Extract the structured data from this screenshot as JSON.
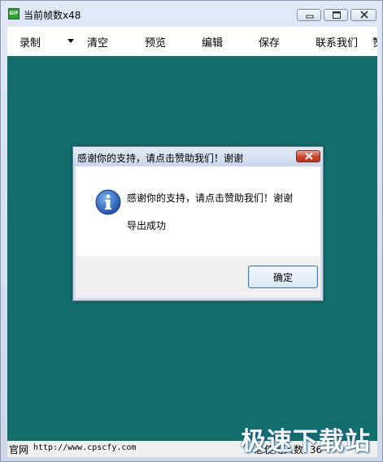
{
  "window": {
    "title": "当前帧数x48",
    "icon": "gif-app-icon"
  },
  "menu": {
    "items": [
      {
        "label": "录制",
        "has_dropdown": true
      },
      {
        "label": "清空"
      },
      {
        "label": "预览"
      },
      {
        "label": "编辑"
      },
      {
        "label": "保存"
      },
      {
        "label": "联系我们"
      },
      {
        "label": "赞"
      }
    ]
  },
  "canvas": {
    "background": "#136d6c"
  },
  "status": {
    "site_label": "官网",
    "site_url": "http://www.cpscfy.com",
    "count": "总使用人数: 36"
  },
  "watermark": "极速下载站",
  "dialog": {
    "title": "感谢你的支持，请点击赞助我们！谢谢",
    "message": "感谢你的支持，请点击赞助我们！谢谢",
    "submessage": "导出成功",
    "ok_label": "确定",
    "icon": "info-icon"
  }
}
